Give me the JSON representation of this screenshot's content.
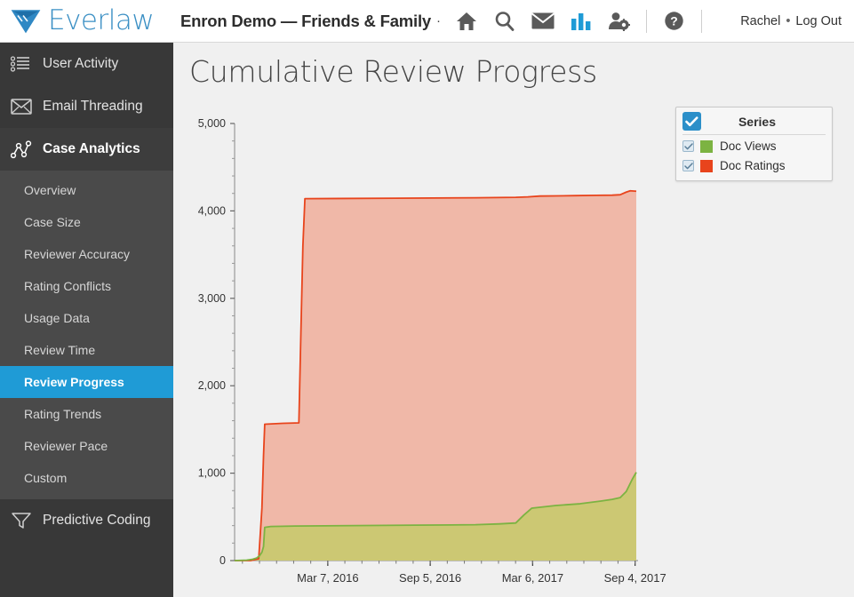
{
  "header": {
    "brand": "Everlaw",
    "brand_color": "#3a8fc4",
    "brand_logo_icon": "everlaw-diamond-logo",
    "case_title": "Enron Demo — Friends & Family",
    "title_suffix_dots": "·",
    "icons": [
      {
        "name": "home-icon",
        "label": "Home"
      },
      {
        "name": "search-icon",
        "label": "Search"
      },
      {
        "name": "mail-icon",
        "label": "Messages"
      },
      {
        "name": "bar-chart-icon",
        "label": "Analytics",
        "active": true,
        "color": "#1f9bd6"
      },
      {
        "name": "user-settings-icon",
        "label": "User Administration"
      },
      {
        "name": "help-icon",
        "label": "Help"
      }
    ],
    "user_name": "Rachel",
    "separator": "•",
    "logout": "Log Out"
  },
  "sidebar": {
    "top_items": [
      {
        "label": "User Activity",
        "icon": "list-activity-icon",
        "active": false
      },
      {
        "label": "Email Threading",
        "icon": "envelope-icon",
        "active": false
      },
      {
        "label": "Case Analytics",
        "icon": "network-graph-icon",
        "active": true
      }
    ],
    "sub_items": [
      {
        "label": "Overview",
        "selected": false
      },
      {
        "label": "Case Size",
        "selected": false
      },
      {
        "label": "Reviewer Accuracy",
        "selected": false
      },
      {
        "label": "Rating Conflicts",
        "selected": false
      },
      {
        "label": "Usage Data",
        "selected": false
      },
      {
        "label": "Review Time",
        "selected": false
      },
      {
        "label": "Review Progress",
        "selected": true
      },
      {
        "label": "Rating Trends",
        "selected": false
      },
      {
        "label": "Reviewer Pace",
        "selected": false
      },
      {
        "label": "Custom",
        "selected": false
      }
    ],
    "bottom_items": [
      {
        "label": "Predictive Coding",
        "icon": "funnel-icon",
        "active": false
      }
    ],
    "selected_color": "#1f9bd6",
    "bg_color": "#383838",
    "sub_bg_color": "#4a4a4a"
  },
  "legend": {
    "title": "Series",
    "master_checkbox_checked": true,
    "items": [
      {
        "label": "Doc Views",
        "color": "#7cb342",
        "checked": true
      },
      {
        "label": "Doc Ratings",
        "color": "#e8441c",
        "checked": true
      }
    ]
  },
  "chart_data": {
    "type": "area",
    "title": "Cumulative Review Progress",
    "xlabel": "",
    "ylabel": "",
    "grid": false,
    "legend_position": "top-right",
    "ylim": [
      0,
      5000
    ],
    "ytick_labels": [
      "0",
      "1,000",
      "2,000",
      "3,000",
      "4,000",
      "5,000"
    ],
    "ytick_values": [
      0,
      1000,
      2000,
      3000,
      4000,
      5000
    ],
    "xtick_labels": [
      "Mar 7, 2016",
      "Sep 5, 2016",
      "Mar 6, 2017",
      "Sep 4, 2017"
    ],
    "xtick_positions": [
      0.232,
      0.487,
      0.742,
      0.997
    ],
    "series": [
      {
        "name": "Doc Ratings",
        "color": "#e8441c",
        "fill": "#f0b8a8",
        "x": [
          0.0,
          0.04,
          0.06,
          0.068,
          0.072,
          0.075,
          0.12,
          0.16,
          0.165,
          0.17,
          0.175,
          0.4,
          0.6,
          0.7,
          0.73,
          0.76,
          0.8,
          0.85,
          0.9,
          0.94,
          0.96,
          0.975,
          0.985,
          1.0
        ],
        "values": [
          0,
          0,
          20,
          600,
          1200,
          1560,
          1570,
          1575,
          2600,
          3600,
          4140,
          4145,
          4150,
          4155,
          4160,
          4170,
          4172,
          4175,
          4178,
          4180,
          4185,
          4215,
          4230,
          4225
        ]
      },
      {
        "name": "Doc Views",
        "color": "#7cb342",
        "fill": "#c6c96b",
        "x": [
          0.0,
          0.03,
          0.045,
          0.055,
          0.062,
          0.068,
          0.072,
          0.075,
          0.09,
          0.15,
          0.3,
          0.45,
          0.6,
          0.66,
          0.7,
          0.72,
          0.74,
          0.76,
          0.8,
          0.86,
          0.91,
          0.94,
          0.96,
          0.975,
          0.99,
          1.0
        ],
        "values": [
          0,
          5,
          15,
          30,
          55,
          95,
          160,
          380,
          390,
          395,
          400,
          405,
          410,
          420,
          430,
          520,
          600,
          610,
          630,
          650,
          680,
          700,
          720,
          790,
          930,
          1010
        ]
      }
    ]
  }
}
